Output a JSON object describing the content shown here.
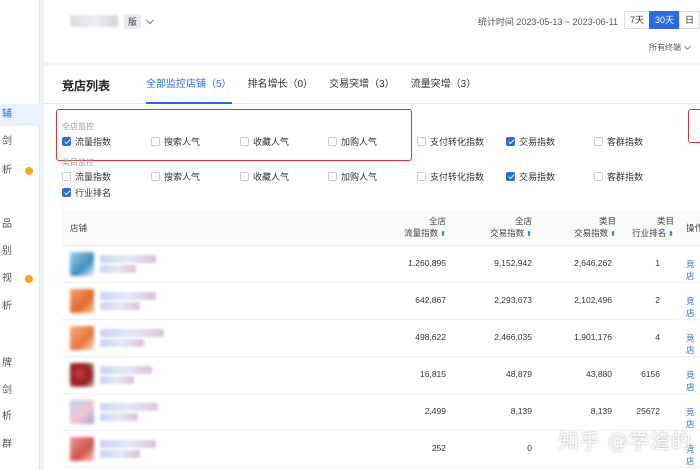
{
  "sidebar": {
    "items": [
      {
        "label": "辅",
        "active": true
      },
      {
        "label": "剑",
        "active": false
      },
      {
        "label": "析",
        "active": false,
        "dot": true
      },
      {
        "label": "品",
        "active": false
      },
      {
        "label": "别",
        "active": false
      },
      {
        "label": "视",
        "active": false,
        "dot": true
      },
      {
        "label": "析",
        "active": false
      },
      {
        "label": "牌",
        "active": false
      },
      {
        "label": "剑",
        "active": false
      },
      {
        "label": "析",
        "active": false
      },
      {
        "label": "群",
        "active": false
      }
    ]
  },
  "header": {
    "store_suffix": "版",
    "stat_time": "统计时间 2023-05-13 ~ 2023-06-11",
    "ranges": [
      {
        "label": "7天",
        "active": false
      },
      {
        "label": "30天",
        "active": true
      },
      {
        "label": "日",
        "active": false
      }
    ],
    "terminal": "所有终端"
  },
  "panel": {
    "title": "竞店列表",
    "tabs": [
      {
        "label": "全部监控店铺（5）",
        "active": true
      },
      {
        "label": "排名增长（0）",
        "active": false
      },
      {
        "label": "交易突增（3）",
        "active": false
      },
      {
        "label": "流量突增（3）",
        "active": false
      }
    ]
  },
  "filters": {
    "group1_label": "全店监控",
    "group1": [
      {
        "label": "流量指数",
        "checked": true
      },
      {
        "label": "搜索人气",
        "checked": false
      },
      {
        "label": "收藏人气",
        "checked": false
      },
      {
        "label": "加购人气",
        "checked": false
      },
      {
        "label": "支付转化指数",
        "checked": false
      },
      {
        "label": "交易指数",
        "checked": true
      },
      {
        "label": "客群指数",
        "checked": false
      }
    ],
    "group2_label": "类目监控",
    "group2": [
      {
        "label": "流量指数",
        "checked": false
      },
      {
        "label": "搜索人气",
        "checked": false
      },
      {
        "label": "收藏人气",
        "checked": false
      },
      {
        "label": "加购人气",
        "checked": false
      },
      {
        "label": "支付转化指数",
        "checked": false
      },
      {
        "label": "交易指数",
        "checked": true
      },
      {
        "label": "客群指数",
        "checked": false
      }
    ],
    "extra": {
      "label": "行业排名",
      "checked": true
    }
  },
  "table": {
    "headers": [
      {
        "line1": "店铺",
        "line2": ""
      },
      {
        "line1": "全店",
        "line2": "流量指数"
      },
      {
        "line1": "全店",
        "line2": "交易指数"
      },
      {
        "line1": "类目",
        "line2": "交易指数"
      },
      {
        "line1": "类目",
        "line2": "行业排名"
      },
      {
        "line1": "操作",
        "line2": ""
      }
    ],
    "rows": [
      {
        "flow": "1,260,895",
        "trade": "9,152,942",
        "cat_trade": "2,646,262",
        "rank": "1",
        "action": "竞店"
      },
      {
        "flow": "642,867",
        "trade": "2,293,673",
        "cat_trade": "2,102,496",
        "rank": "2",
        "action": "竞店"
      },
      {
        "flow": "498,622",
        "trade": "2,466,035",
        "cat_trade": "1,901,176",
        "rank": "4",
        "action": "竞店"
      },
      {
        "flow": "16,815",
        "trade": "48,879",
        "cat_trade": "43,880",
        "rank": "6156",
        "action": "竞店"
      },
      {
        "flow": "2,499",
        "trade": "8,139",
        "cat_trade": "8,139",
        "rank": "25672",
        "action": "竞店"
      },
      {
        "flow": "252",
        "trade": "0",
        "cat_trade": "",
        "rank": "",
        "action": "竞店"
      }
    ]
  },
  "watermark": "知乎 @学渣的"
}
